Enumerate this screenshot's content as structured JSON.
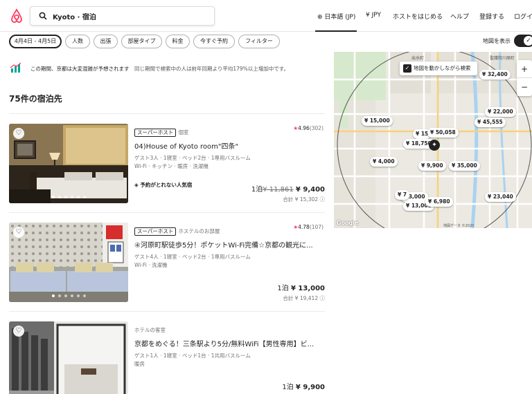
{
  "header": {
    "search_text": "Kyoto · 宿泊",
    "language": "日本語 (JP)",
    "currency": "¥ JPY",
    "host": "ホストをはじめる",
    "help": "ヘルプ",
    "signup": "登録する",
    "login": "ログイ"
  },
  "filters": {
    "dates": "4月4日 - 4月5日",
    "guests": "人数",
    "business": "出張",
    "room_type": "部屋タイプ",
    "price": "料金",
    "instant": "今すぐ予約",
    "more": "フィルター",
    "map_toggle_label": "地図を表示"
  },
  "notice": {
    "text": "この期間、京都は大変混雑が予想されます",
    "detail": "同じ期間で検索中の人は前年同期より平均179%以上増加中です。"
  },
  "results_count": "75件の宿泊先",
  "listings": [
    {
      "badge": "スーパーホスト",
      "type": "個室",
      "rating": "4.96",
      "reviews": "(302)",
      "title": "04)House of Kyoto room\"四条\"",
      "details": "ゲスト3人 · 1寝室 · ベッド2台 · 1専用バスルーム",
      "amenities": "Wi-Fi · キッチン · 暖房 · 洗濯機",
      "rare": "予約がとれない人気宿",
      "price_prefix": "1泊",
      "old_price": "¥ 11,861",
      "price": "¥ 9,400",
      "total": "合計 ¥ 15,302"
    },
    {
      "badge": "スーパーホスト",
      "type": "ホステルのお部屋",
      "rating": "4.78",
      "reviews": "(107)",
      "title": "④河原町駅徒歩5分！ポケットWi-Fi完備☆京都の観光に...",
      "details": "ゲスト4人 · 1寝室 · ベッド2台 · 1専用バスルーム",
      "amenities": "Wi-Fi · 洗濯機",
      "price_prefix": "1泊",
      "price": "¥ 13,000",
      "total": "合計 ¥ 19,412"
    },
    {
      "type": "ホテルの客室",
      "title": "京都をめぐる！三条駅より5分/無料WiFi【男性専用】ビ...",
      "details": "ゲスト1人 · 1寝室 · ベッド1台 · 1共用バスルーム",
      "amenities": "暖房",
      "price_prefix": "1泊",
      "price": "¥ 9,900"
    }
  ],
  "map": {
    "move_search": "地図を動かしながら検索",
    "zoom_in": "+",
    "zoom_out": "−",
    "station_label": "出水町",
    "label_2": "聖護院川原町",
    "google": "Google",
    "attribution": "地図データ ©2020",
    "pins": [
      "¥ 32,400",
      "¥ 15,000",
      "¥ 22,000",
      "¥ 45,555",
      "¥ 15",
      "¥ 50,058",
      "¥ 18,750",
      "¥ 4,000",
      "¥ 9,900",
      "¥ 35,000",
      "¥ 3,000",
      "¥ 13,000",
      "¥ 6,980",
      "¥ 23,040",
      "¥ 7"
    ]
  }
}
